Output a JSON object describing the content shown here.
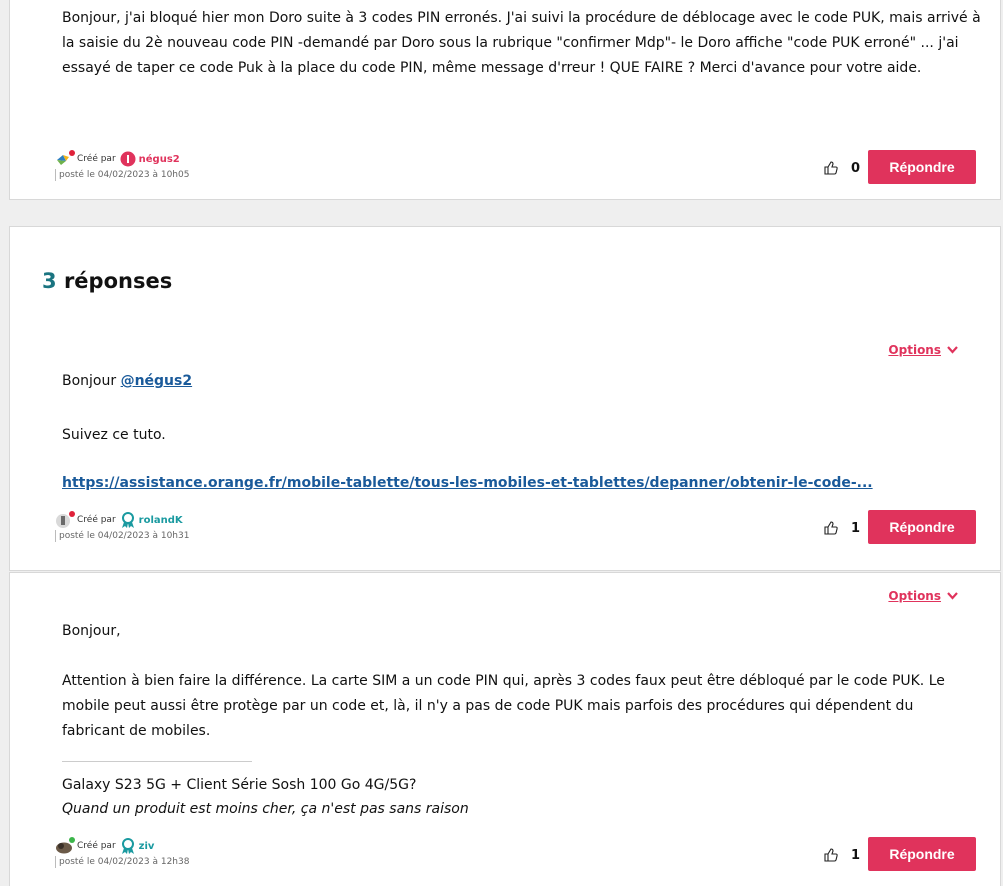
{
  "question": {
    "body": "Bonjour, j'ai bloqué hier mon Doro suite à 3 codes PIN erronés. J'ai suivi la procédure de déblocage avec le code PUK, mais arrivé à la saisie du 2è nouveau code PIN -demandé par Doro sous la rubrique \"confirmer Mdp\"- le Doro affiche \"code PUK erroné\" ... j'ai essayé de taper ce code Puk à la place du code PIN, même message d'rreur ! QUE FAIRE ? Merci d'avance pour votre aide.",
    "created_by_label": "Créé par",
    "author": "négus2",
    "posted": "posté le 04/02/2023 à 10h05",
    "votes": "0",
    "reply_label": "Répondre"
  },
  "replies_header": {
    "count": "3",
    "label": "réponses"
  },
  "reply1": {
    "options_label": "Options",
    "greeting_prefix": "Bonjour ",
    "mention": "@négus2",
    "line2": "Suivez ce tuto.",
    "link": "https://assistance.orange.fr/mobile-tablette/tous-les-mobiles-et-tablettes/depanner/obtenir-le-code-...",
    "created_by_label": "Créé par",
    "author": "rolandK",
    "posted": "posté le 04/02/2023 à 10h31",
    "votes": "1",
    "reply_label": "Répondre"
  },
  "reply2": {
    "options_label": "Options",
    "greeting": "Bonjour,",
    "body": "Attention à bien faire la différence. La carte SIM a un code PIN qui, après 3 codes faux peut être débloqué par le code PUK. Le mobile peut aussi être protège par un code et, là, il n'y a pas de code PUK mais parfois des procédures qui dépendent du fabricant de mobiles.",
    "signature_line1": "Galaxy S23 5G + Client Série Sosh 100 Go 4G/5G?",
    "signature_line2": "Quand un produit est moins cher, ça n'est pas sans raison",
    "created_by_label": "Créé par",
    "author": "ziv",
    "posted": "posté le 04/02/2023 à 12h38",
    "votes": "1",
    "reply_label": "Répondre"
  },
  "icons": {
    "thumbs_up": "thumbs-up-icon",
    "chevron": "chevron-down-icon",
    "rank_badge": "rank-ribbon-icon"
  },
  "colors": {
    "accent": "#e0335c",
    "teal": "#1a7480",
    "link": "#1a5a9a"
  }
}
